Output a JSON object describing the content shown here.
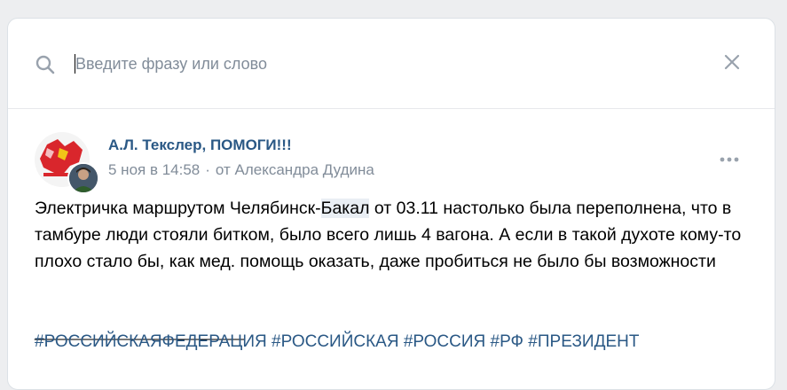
{
  "search": {
    "placeholder": "Введите фразу или слово",
    "value": "",
    "icon": "search-icon",
    "clear_icon": "close-icon"
  },
  "post": {
    "author": "А.Л. Текслер, ПОМОГИ!!!",
    "date": "5 ноя в 14:58",
    "separator": "·",
    "from": "от Александра Дудина",
    "text_before_highlight": "Электричка маршрутом Челябинск-",
    "highlight": "Бакал",
    "text_after_highlight": " от 03.11 настолько была переполнена, что в тамбуре люди стояли битком, было всего лишь 4 вагона. А если в такой духоте кому-то плохо стало бы, как мед. помощь оказать, даже пробиться не было бы возможности",
    "divider": "_________________________",
    "hashtags": [
      "#РОССИЙСКАЯФЕДЕРАЦИЯ",
      "#РОССИЙСКАЯ",
      "#РОССИЯ",
      "#РФ",
      "#ПРЕЗИДЕНТ"
    ],
    "more_icon": "more-horizontal-icon"
  },
  "colors": {
    "link": "#2a5885",
    "secondary": "#818c99",
    "background": "#edeef0",
    "highlight": "#e9eef4"
  }
}
